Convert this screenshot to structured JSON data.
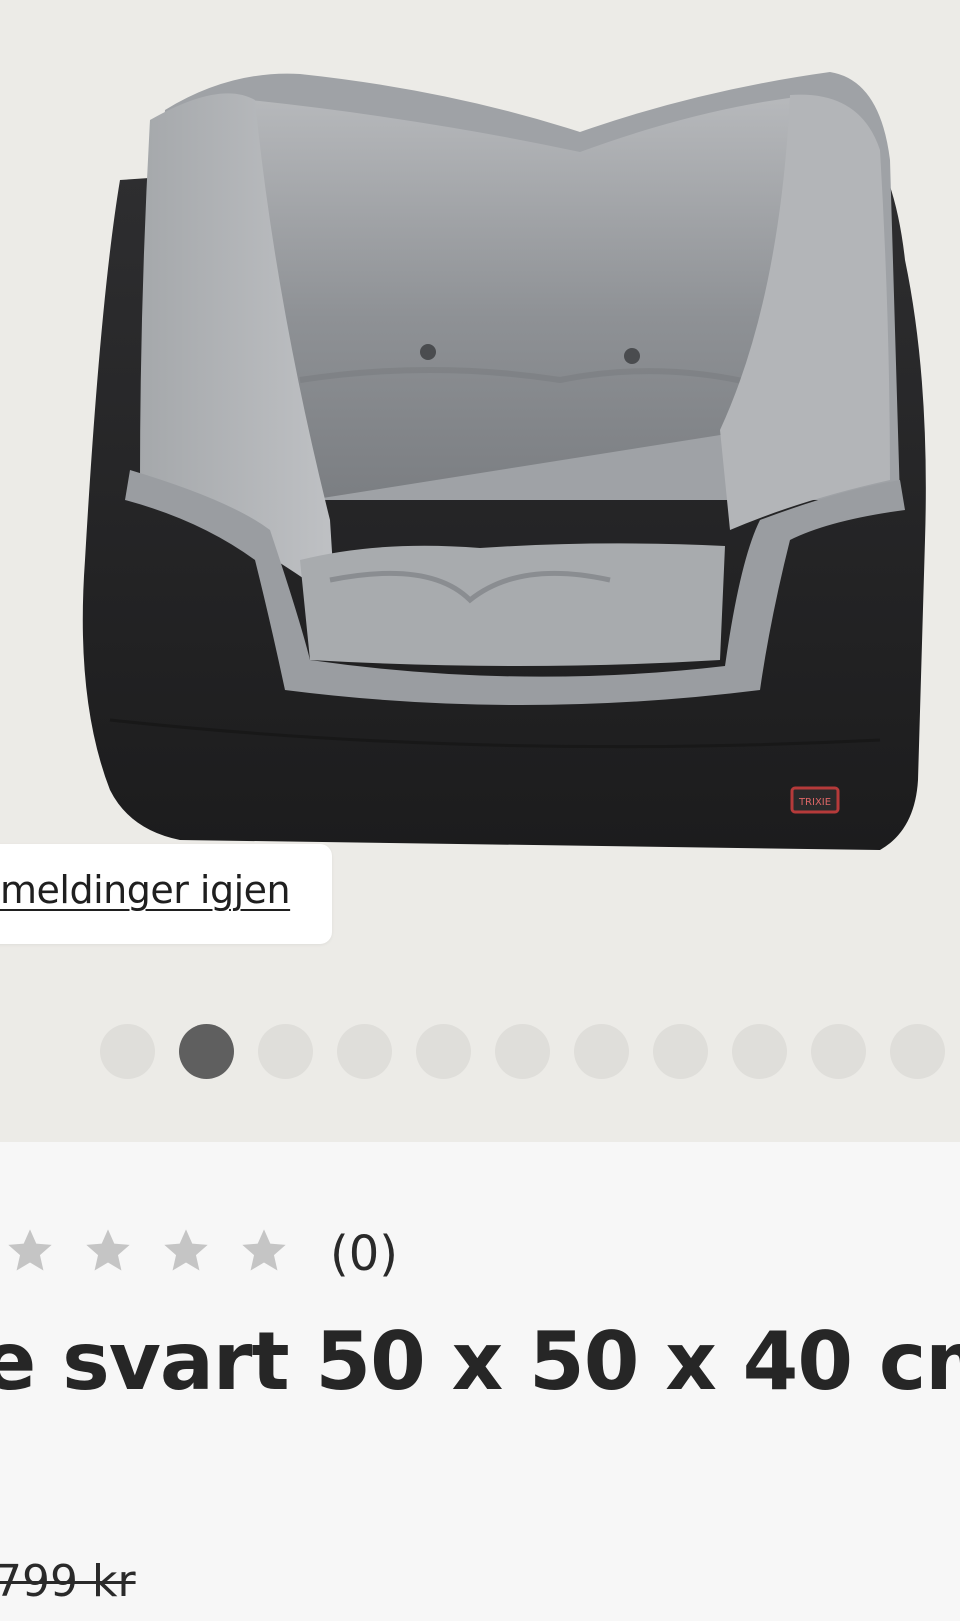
{
  "gallery": {
    "image_alt": "Dog car seat bed, black with grey plush lining",
    "image_brand_tag": "TRIXIE",
    "dot_count": 11,
    "active_index": 1
  },
  "toast": {
    "link_text": "meldinger igjen"
  },
  "product": {
    "rating": {
      "value": 0,
      "max": 5,
      "visible_stars": 4,
      "count_label": "(0)"
    },
    "title_visible": "e svart 50 x 50 x 40 cm",
    "old_price": "799 kr"
  },
  "colors": {
    "gallery_bg": "#ecebe7",
    "dot_inactive": "#dfdeda",
    "dot_active": "#5f5f5f",
    "star": "#c5c5c5",
    "text": "#262626"
  }
}
